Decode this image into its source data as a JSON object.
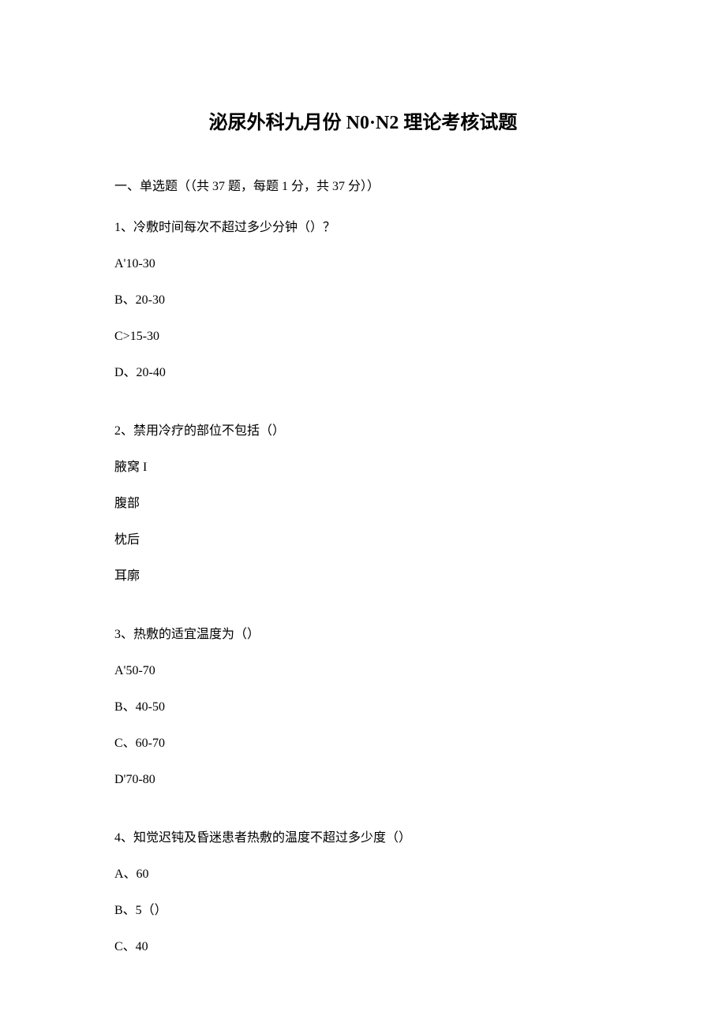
{
  "title": "泌尿外科九月份 N0·N2 理论考核试题",
  "section_header": "一、单选题（（共 37 题，每题 1 分，共 37 分））",
  "questions": [
    {
      "stem": "1、冷敷时间每次不超过多少分钟（）？",
      "options": [
        "A'10-30",
        "B、20-30",
        "C>15-30",
        "D、20-40"
      ]
    },
    {
      "stem": "2、禁用冷疗的部位不包括（）",
      "options": [
        "腋窝 I",
        "腹部",
        "枕后",
        "耳廓"
      ]
    },
    {
      "stem": "3、热敷的适宜温度为（）",
      "options": [
        "A'50-70",
        "B、40-50",
        "C、60-70",
        "D'70-80"
      ]
    },
    {
      "stem": "4、知觉迟钝及昏迷患者热敷的温度不超过多少度（）",
      "options": [
        "A、60",
        "B、5（）",
        "C、40"
      ]
    }
  ]
}
